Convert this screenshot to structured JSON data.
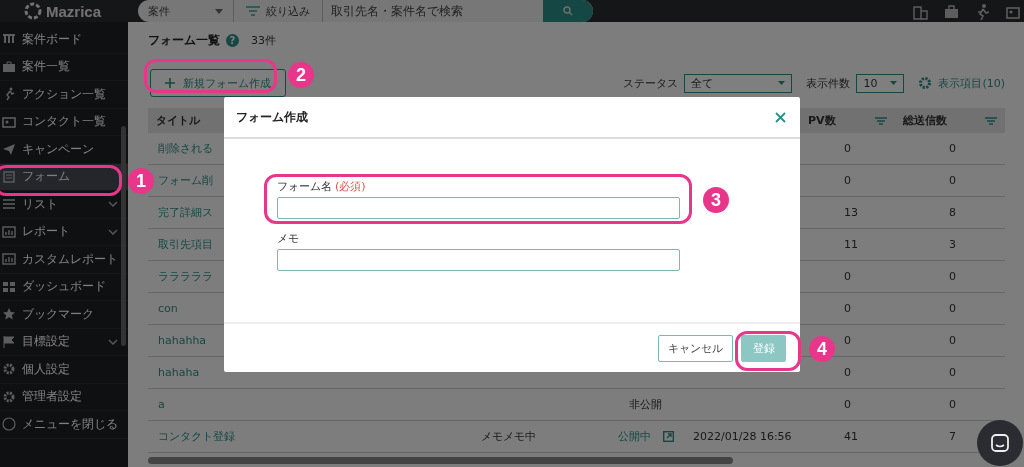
{
  "topbar": {
    "logo": "Mazrica",
    "category_select": "案件",
    "filter_button": "絞り込み",
    "search": {
      "placeholder": "取引先名・案件名で検索"
    }
  },
  "sidebar": {
    "items": [
      {
        "label": "案件ボード",
        "selected": false,
        "has_submenu": false
      },
      {
        "label": "案件一覧",
        "selected": false,
        "has_submenu": false
      },
      {
        "label": "アクション一覧",
        "selected": false,
        "has_submenu": false
      },
      {
        "label": "コンタクト一覧",
        "selected": false,
        "has_submenu": false
      },
      {
        "label": "キャンペーン",
        "selected": false,
        "has_submenu": false
      },
      {
        "label": "フォーム",
        "selected": true,
        "has_submenu": false
      },
      {
        "label": "リスト",
        "selected": false,
        "has_submenu": true
      },
      {
        "label": "レポート",
        "selected": false,
        "has_submenu": true
      },
      {
        "label": "カスタムレポート",
        "selected": false,
        "has_submenu": false
      },
      {
        "label": "ダッシュボード",
        "selected": false,
        "has_submenu": false
      },
      {
        "label": "ブックマーク",
        "selected": false,
        "has_submenu": false
      },
      {
        "label": "目標設定",
        "selected": false,
        "has_submenu": true
      },
      {
        "label": "個人設定",
        "selected": false,
        "has_submenu": false
      },
      {
        "label": "管理者設定",
        "selected": false,
        "has_submenu": false
      }
    ],
    "collapse_label": "メニューを閉じる"
  },
  "page": {
    "title": "フォーム一覧",
    "help_icon": "?",
    "count": "33件",
    "new_button": "新規フォーム作成",
    "status_label": "ステータス",
    "status_select": "全て",
    "per_page_label": "表示件数",
    "per_page_select": "10",
    "columns_button": "表示項目(10)"
  },
  "table": {
    "columns": [
      "タイトル",
      "PV数",
      "総送信数"
    ],
    "rows": [
      {
        "title": "削除される",
        "pv": "0",
        "sent": "0",
        "external_link": false
      },
      {
        "title": "フォーム削",
        "pv": "0",
        "sent": "0",
        "external_link": false
      },
      {
        "title": "完了詳細ス",
        "pv": "13",
        "sent": "8",
        "external_link": false
      },
      {
        "title": "取引先項目",
        "pv": "11",
        "sent": "3",
        "external_link": false
      },
      {
        "title": "ラララララ",
        "pv": "0",
        "sent": "0",
        "external_link": false
      },
      {
        "title": "con",
        "pv": "0",
        "sent": "0",
        "external_link": false
      },
      {
        "title": "hahahha",
        "pv": "0",
        "sent": "0",
        "external_link": false
      },
      {
        "title": "hahaha",
        "pv": "0",
        "sent": "0",
        "external_link": false
      },
      {
        "title": "a",
        "status": "非公開",
        "pv": "0",
        "sent": "0",
        "external_link": false
      },
      {
        "title": "コンタクト登録",
        "memo": "メモメモ中",
        "status": "公開中",
        "date": "2022/01/28 16:56",
        "pv": "41",
        "sent": "7",
        "external_link": true
      }
    ]
  },
  "modal": {
    "title": "フォーム作成",
    "fields": [
      {
        "label": "フォーム名",
        "required_mark": "(必須)"
      },
      {
        "label": "メモ"
      }
    ],
    "buttons": [
      {
        "label": "キャンセル",
        "kind": "secondary"
      },
      {
        "label": "登録",
        "kind": "primary"
      }
    ]
  },
  "annotations": [
    {
      "number": "1"
    },
    {
      "number": "2"
    },
    {
      "number": "3"
    },
    {
      "number": "4"
    }
  ]
}
